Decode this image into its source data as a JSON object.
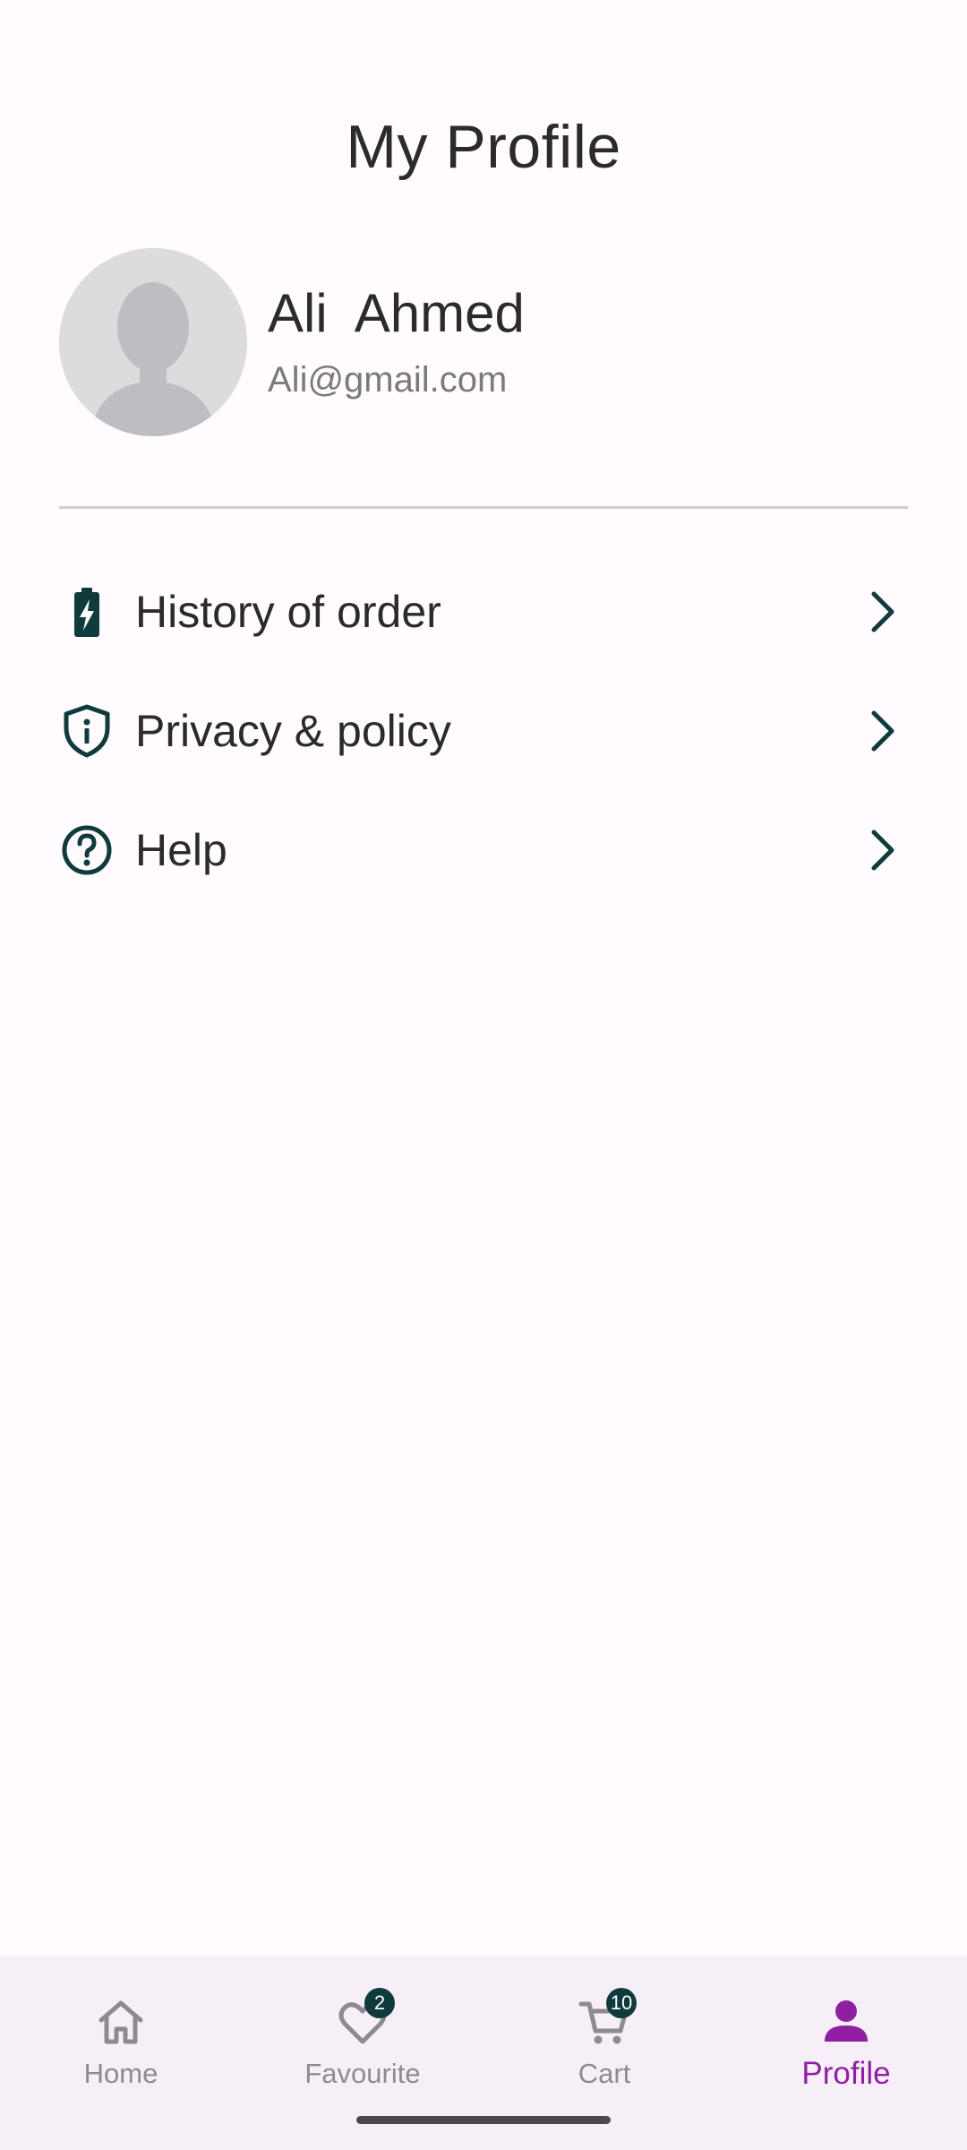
{
  "page": {
    "title": "My Profile"
  },
  "profile": {
    "name": "Ali  Ahmed",
    "email": "Ali@gmail.com",
    "avatar_icon": "default-person-avatar"
  },
  "menu": {
    "items": [
      {
        "label": "History of order",
        "icon": "battery-charging-icon"
      },
      {
        "label": "Privacy & policy",
        "icon": "shield-info-icon"
      },
      {
        "label": "Help",
        "icon": "help-circle-icon"
      }
    ],
    "icon_color": "#0f3b3c"
  },
  "bottom_nav": {
    "items": [
      {
        "label": "Home",
        "icon": "home-icon",
        "badge": null,
        "active": false
      },
      {
        "label": "Favourite",
        "icon": "heart-icon",
        "badge": "2",
        "active": false
      },
      {
        "label": "Cart",
        "icon": "cart-icon",
        "badge": "10",
        "active": false
      },
      {
        "label": "Profile",
        "icon": "person-icon",
        "badge": null,
        "active": true
      }
    ],
    "active_color": "#8f1fa3",
    "inactive_color": "#8e8a90",
    "badge_color": "#0f3b3c",
    "background": "#f7eff8"
  }
}
